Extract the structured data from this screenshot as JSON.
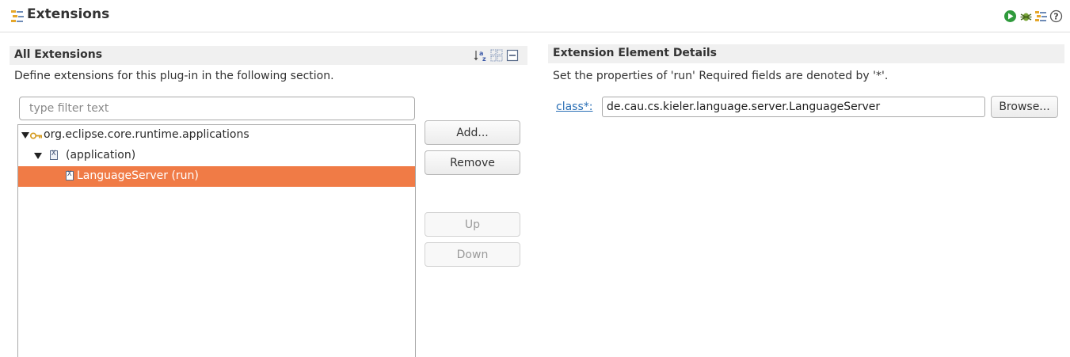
{
  "header": {
    "title": "Extensions",
    "title_icon": "extensions-icon",
    "toolbar_icons": [
      "run-icon",
      "debug-icon",
      "extensions-icon",
      "help-icon"
    ]
  },
  "left": {
    "section_title": "All Extensions",
    "section_icons": [
      "sort-alpha-icon",
      "expand-all-icon",
      "collapse-all-icon"
    ],
    "description": "Define extensions for this plug-in in the following section.",
    "filter_placeholder": "type filter text",
    "filter_value": "",
    "tree": [
      {
        "label": "org.eclipse.core.runtime.applications",
        "level": 0,
        "expanded": true,
        "icon": "extension-point-icon",
        "selected": false
      },
      {
        "label": "(application)",
        "level": 1,
        "expanded": true,
        "icon": "xml-element-icon",
        "selected": false
      },
      {
        "label": "LanguageServer (run)",
        "level": 2,
        "expanded": false,
        "icon": "xml-element-icon",
        "selected": true
      }
    ],
    "buttons": {
      "add": "Add...",
      "remove": "Remove",
      "up": "Up",
      "down": "Down"
    }
  },
  "right": {
    "section_title": "Extension Element Details",
    "description": "Set the properties of 'run' Required fields are denoted by '*'.",
    "class_label": "class*:",
    "class_value": "de.cau.cs.kieler.language.server.LanguageServer",
    "browse_label": "Browse..."
  },
  "colors": {
    "selection": "#f07b46",
    "section_header_bg": "#f0f0f0",
    "link": "#2a6fb5"
  }
}
